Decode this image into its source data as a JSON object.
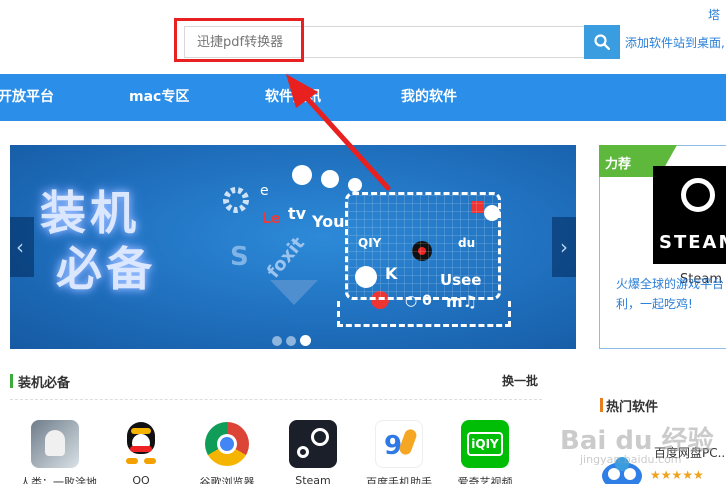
{
  "header": {
    "top_link": "塔",
    "search_placeholder": "迅捷pdf转换器",
    "add_desktop": "添加软件站到桌面,"
  },
  "nav": {
    "items": [
      "开放平台",
      "mac专区",
      "软件资讯",
      "我的软件"
    ]
  },
  "banner": {
    "title_line1": "装机",
    "title_line2": "必备",
    "slides": 3,
    "active_slide": 3
  },
  "section": {
    "title": "装机必备",
    "more": "换一批",
    "apps": [
      {
        "name": "人类：一败涂地",
        "icon": "human-fall-flat-icon"
      },
      {
        "name": "QQ",
        "icon": "qq-penguin-icon"
      },
      {
        "name": "谷歌浏览器",
        "icon": "chrome-icon"
      },
      {
        "name": "Steam",
        "icon": "steam-icon"
      },
      {
        "name": "百度手机助手",
        "icon": "baidu-assistant-icon"
      },
      {
        "name": "爱奇艺视频",
        "icon": "iqiyi-icon"
      }
    ]
  },
  "featured": {
    "tag": "力荐",
    "logo_text": "STEAM",
    "name": "Steam",
    "desc": "火爆全球的游戏平台利，一起吃鸡!"
  },
  "hot": {
    "title": "热门软件",
    "items": [
      {
        "name": "百度网盘PC...",
        "stars": "★★★★★",
        "icon": "baidu-netdisk-icon"
      }
    ]
  },
  "watermark": {
    "text": "Bai du 经验",
    "sub": "jingyan.baidu.com"
  },
  "colors": {
    "nav_blue": "#2b8ee8",
    "annotation_red": "#e8201f",
    "section_green": "#3daa3a",
    "hot_orange": "#e87d1e"
  }
}
